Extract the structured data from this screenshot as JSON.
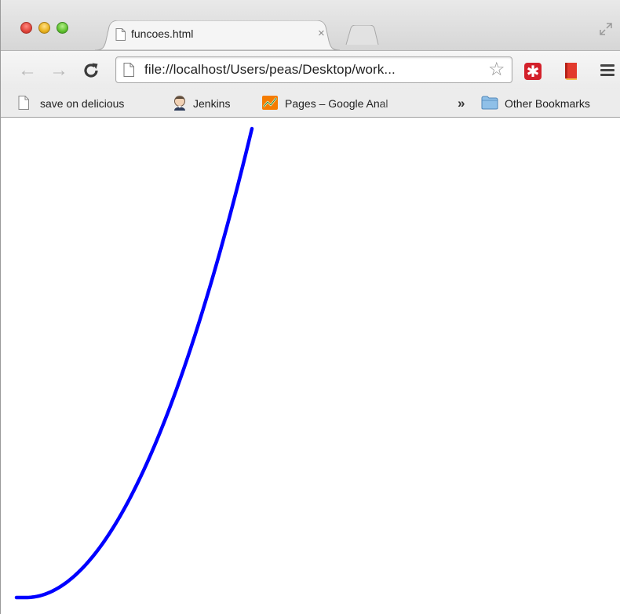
{
  "tab": {
    "title": "funcoes.html",
    "close_glyph": "×"
  },
  "toolbar": {
    "back_glyph": "←",
    "forward_glyph": "→",
    "url": "file://localhost/Users/peas/Desktop/work...",
    "star_glyph": "☆"
  },
  "extensions": {
    "lastpass_glyph": "✱"
  },
  "bookmarks": {
    "items": [
      {
        "label": "save on delicious",
        "icon": "page-icon"
      },
      {
        "label": "Jenkins",
        "icon": "jenkins-icon"
      },
      {
        "label": "Pages – Google Anal",
        "icon": "analytics-icon"
      }
    ],
    "overflow_glyph": "»",
    "other_label": "Other Bookmarks"
  },
  "colors": {
    "curve": "#0000ff",
    "lastpass": "#d3202a",
    "analytics": "#f57c00"
  },
  "icons": [
    "traffic-close-icon",
    "traffic-minimize-icon",
    "traffic-zoom-icon",
    "page-icon",
    "reload-icon",
    "star-icon",
    "lastpass-icon",
    "book-icon",
    "menu-icon",
    "folder-icon",
    "fullscreen-icon"
  ]
}
